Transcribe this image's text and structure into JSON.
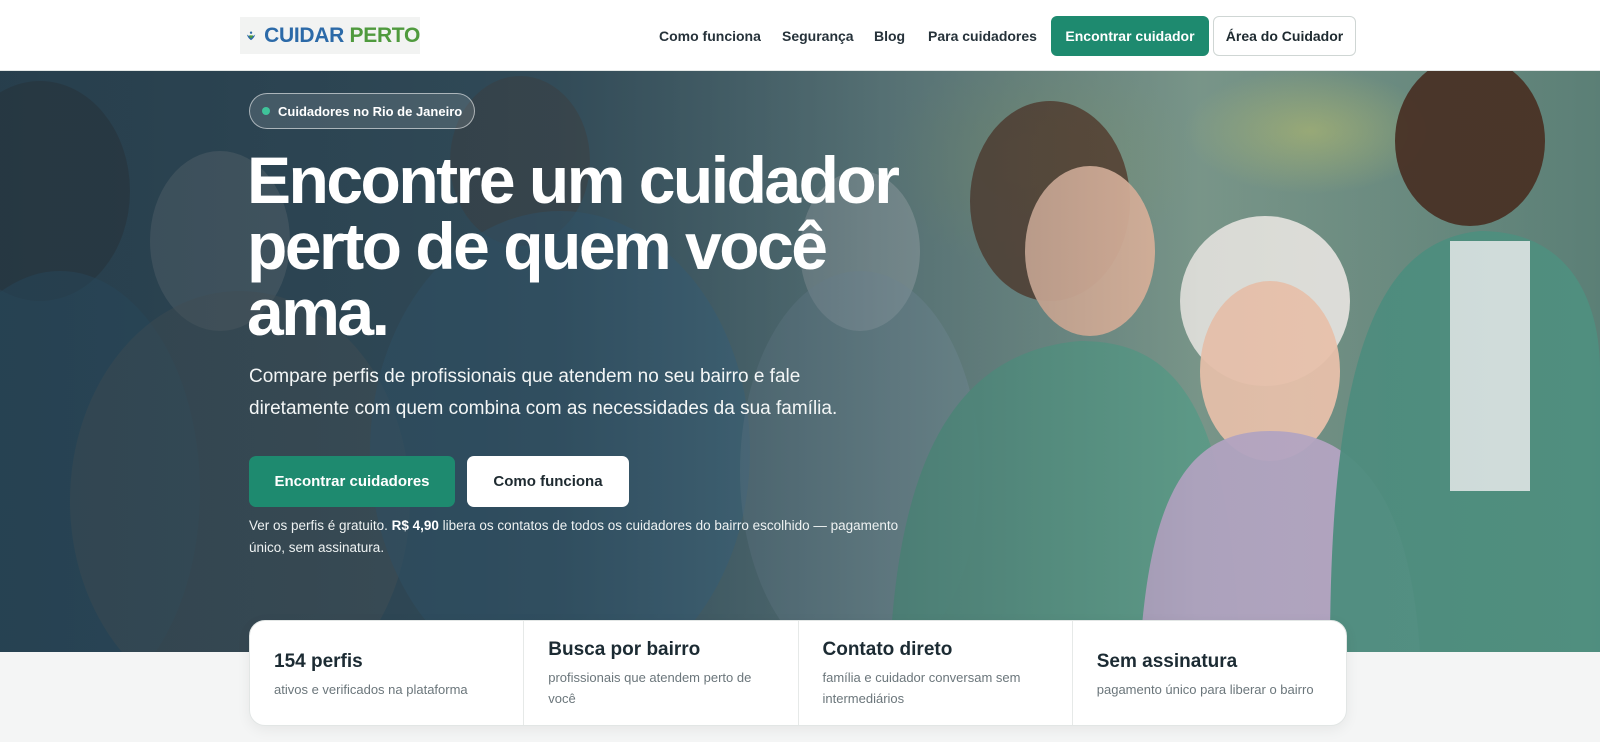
{
  "header": {
    "logo_words": [
      "CUIDAR",
      "PERTO"
    ],
    "nav": [
      "Como funciona",
      "Segurança",
      "Blog",
      "Para cuidadores"
    ],
    "primary_button": "Encontrar cuidador",
    "secondary_button": "Área do Cuidador"
  },
  "hero": {
    "badge": "Cuidadores no Rio de Janeiro",
    "title_lines": [
      "Encontre um cuidador",
      "perto de quem você",
      "ama."
    ],
    "subtitle_lines": [
      "Compare perfis de profissionais que atendem no seu bairro e fale",
      "diretamente com quem combina com as necessidades da sua família."
    ],
    "primary_button": "Encontrar cuidadores",
    "secondary_button": "Como funciona",
    "note_before": "Ver os perfis é gratuito.",
    "note_price": "R$ 4,90",
    "note_after": "libera os contatos de todos os cuidadores do bairro escolhido — pagamento único, sem assinatura."
  },
  "features": [
    {
      "title": "154 perfis",
      "desc": "ativos e verificados na plataforma"
    },
    {
      "title": "Busca por bairro",
      "desc": "profissionais que atendem perto de você"
    },
    {
      "title": "Contato direto",
      "desc": "família e cuidador conversam sem intermediários"
    },
    {
      "title": "Sem assinatura",
      "desc": "pagamento único para liberar o bairro"
    }
  ],
  "colors": {
    "brand_green": "#1e8a6f",
    "logo_blue": "#2c6aa8",
    "logo_green": "#4f9a3d",
    "badge_dot": "#3fc39a"
  },
  "icons": {
    "logo": "heart-hands-logo-icon",
    "badge": "status-dot-icon"
  }
}
